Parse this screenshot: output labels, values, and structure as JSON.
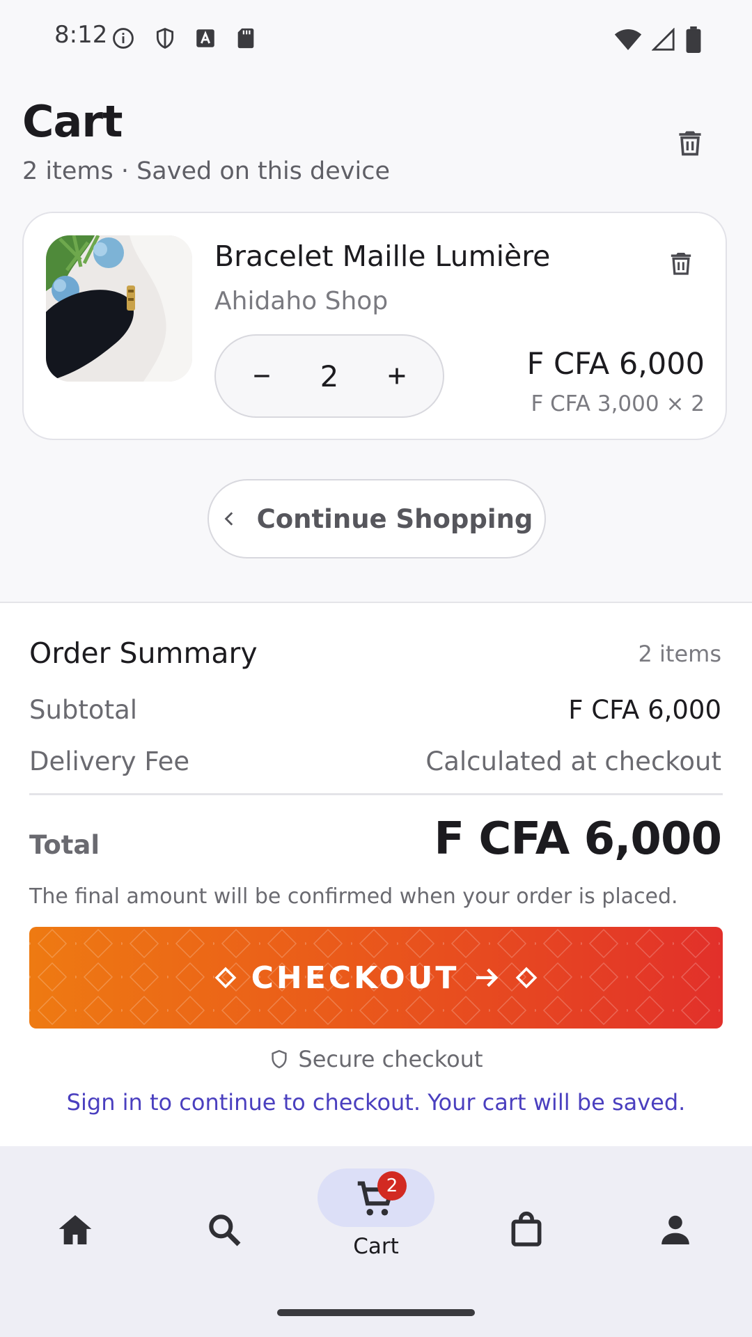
{
  "status_bar": {
    "time": "8:12"
  },
  "header": {
    "title": "Cart",
    "subtitle": "2 items · Saved on this device"
  },
  "cart_item": {
    "name": "Bracelet Maille Lumière",
    "shop": "Ahidaho Shop",
    "quantity": "2",
    "line_total": "F CFA 6,000",
    "unit_price": "F CFA 3,000 × 2"
  },
  "continue_button": {
    "label": "Continue Shopping"
  },
  "summary": {
    "title": "Order Summary",
    "count": "2 items",
    "subtotal_label": "Subtotal",
    "subtotal_value": "F CFA 6,000",
    "delivery_label": "Delivery Fee",
    "delivery_value": "Calculated at checkout",
    "total_label": "Total",
    "total_value": "F CFA 6,000",
    "note": "The final amount will be confirmed when your order is placed."
  },
  "checkout": {
    "label": "CHECKOUT"
  },
  "secure_text": "Secure checkout",
  "signin_text": "Sign in to continue to checkout. Your cart will be saved.",
  "nav": {
    "active_label": "Cart",
    "cart_badge": "2"
  },
  "colors": {
    "accent_start": "#ee7a12",
    "accent_end": "#e2302a",
    "link": "#4a3fbf",
    "badge": "#d22a22"
  }
}
